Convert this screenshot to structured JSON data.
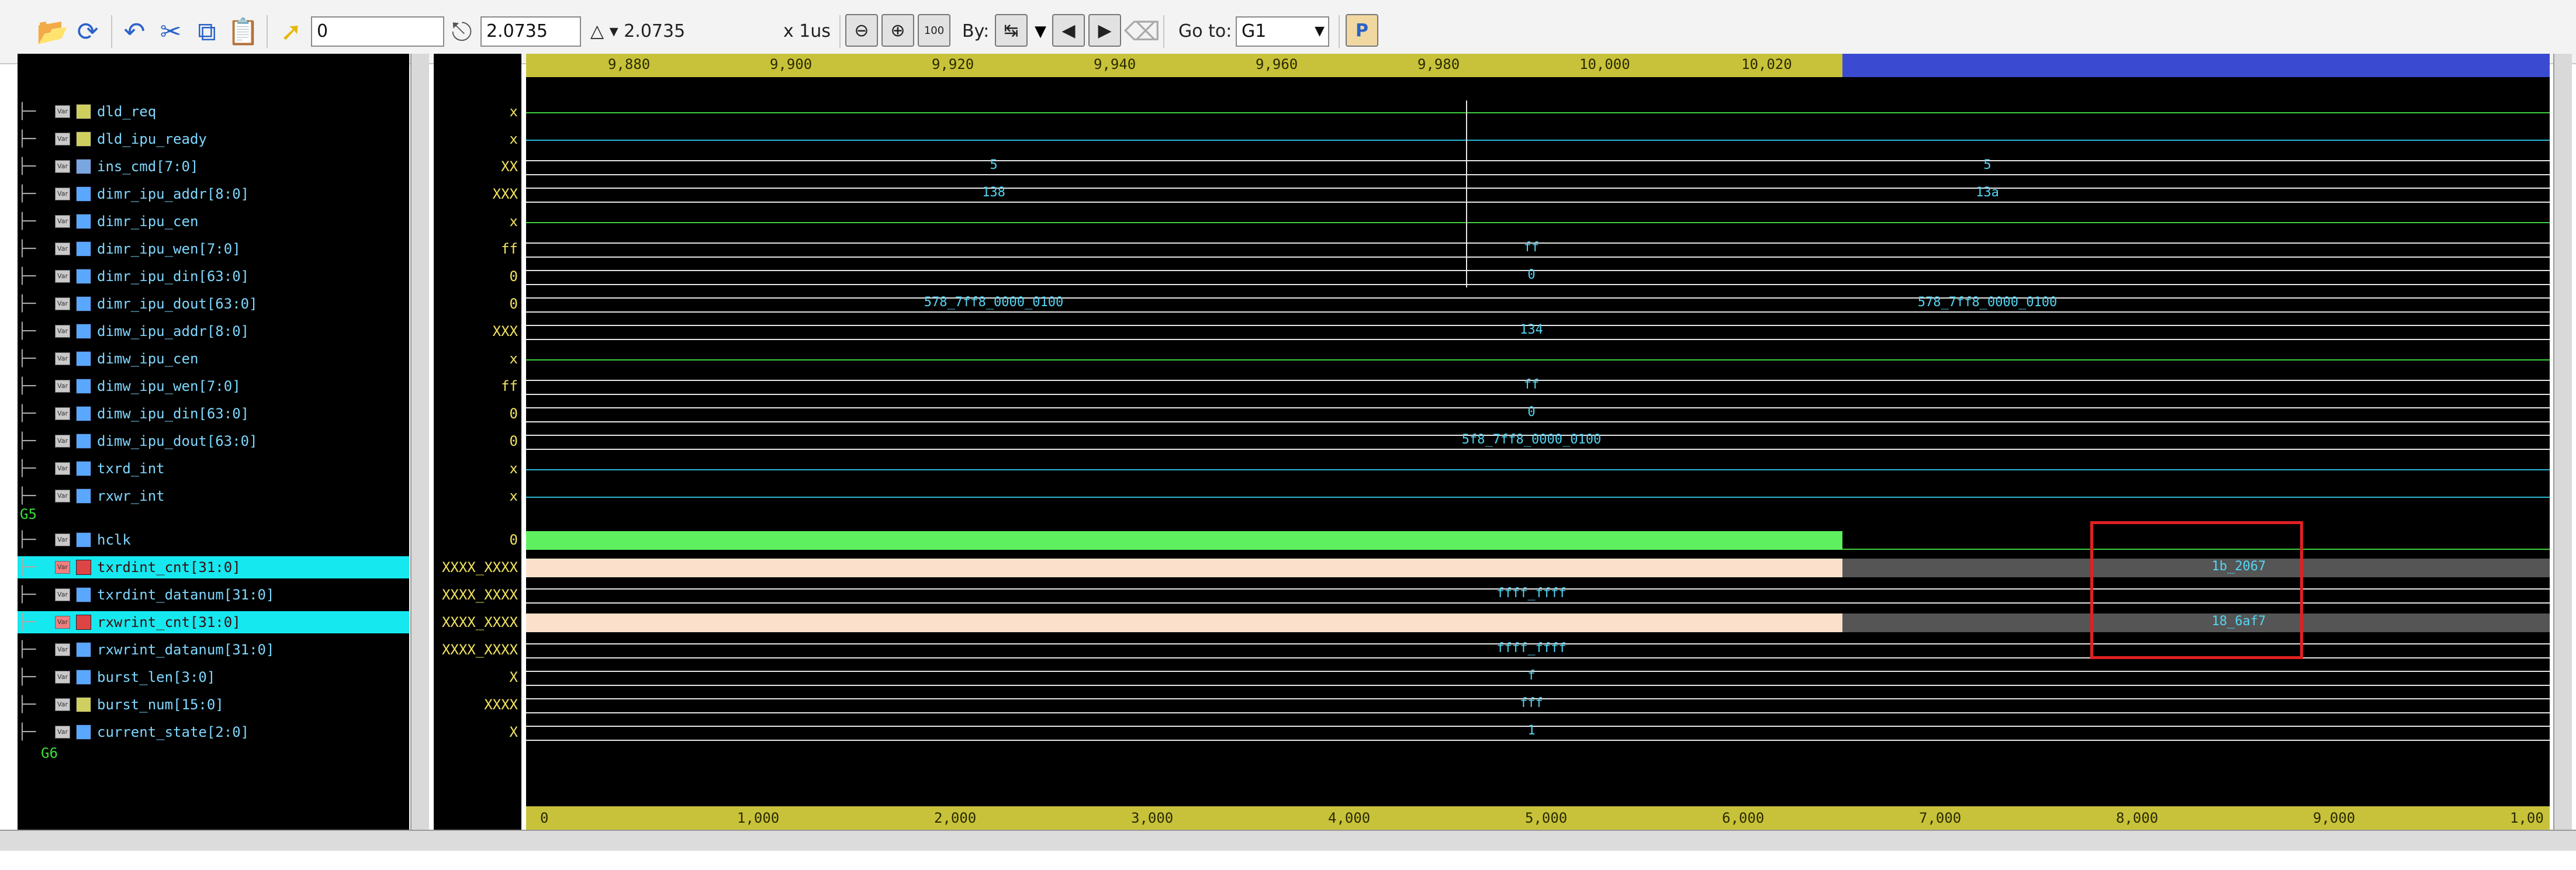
{
  "toolbar": {
    "time_field": "0",
    "marker_field": "2.0735",
    "delta_label": "△ ▾ 2.0735",
    "unit_label": "x 1us",
    "by_label": "By:",
    "goto_label": "Go to:",
    "goto_value": "G1",
    "fit_zoom_label": "100"
  },
  "top_ruler": [
    "9,880",
    "9,900",
    "9,920",
    "9,940",
    "9,960",
    "9,980",
    "10,000",
    "10,020"
  ],
  "bottom_ruler": [
    "0",
    "1,000",
    "2,000",
    "3,000",
    "4,000",
    "5,000",
    "6,000",
    "7,000",
    "8,000",
    "9,000",
    "1,00"
  ],
  "groups": {
    "g5": "G5",
    "g6": "G6"
  },
  "signals": [
    {
      "name": "dld_req",
      "value": "x",
      "type": "wire"
    },
    {
      "name": "dld_ipu_ready",
      "value": "x",
      "type": "wire"
    },
    {
      "name": "ins_cmd[7:0]",
      "value": "XX",
      "type": "bus"
    },
    {
      "name": "dimr_ipu_addr[8:0]",
      "value": "XXX",
      "type": "in"
    },
    {
      "name": "dimr_ipu_cen",
      "value": "x",
      "type": "in"
    },
    {
      "name": "dimr_ipu_wen[7:0]",
      "value": "ff",
      "type": "in"
    },
    {
      "name": "dimr_ipu_din[63:0]",
      "value": "0",
      "type": "in"
    },
    {
      "name": "dimr_ipu_dout[63:0]",
      "value": "0",
      "type": "out"
    },
    {
      "name": "dimw_ipu_addr[8:0]",
      "value": "XXX",
      "type": "in"
    },
    {
      "name": "dimw_ipu_cen",
      "value": "x",
      "type": "in"
    },
    {
      "name": "dimw_ipu_wen[7:0]",
      "value": "ff",
      "type": "in"
    },
    {
      "name": "dimw_ipu_din[63:0]",
      "value": "0",
      "type": "in"
    },
    {
      "name": "dimw_ipu_dout[63:0]",
      "value": "0",
      "type": "out"
    },
    {
      "name": "txrd_int",
      "value": "x",
      "type": "out"
    },
    {
      "name": "rxwr_int",
      "value": "x",
      "type": "out"
    },
    {
      "name": "hclk",
      "value": "0",
      "type": "out"
    },
    {
      "name": "txrdint_cnt[31:0]",
      "value": "XXXX_XXXX",
      "type": "reg",
      "selected": true
    },
    {
      "name": "txrdint_datanum[31:0]",
      "value": "XXXX_XXXX",
      "type": "out"
    },
    {
      "name": "rxwrint_cnt[31:0]",
      "value": "XXXX_XXXX",
      "type": "reg",
      "selected": true
    },
    {
      "name": "rxwrint_datanum[31:0]",
      "value": "XXXX_XXXX",
      "type": "out"
    },
    {
      "name": "burst_len[3:0]",
      "value": "X",
      "type": "in"
    },
    {
      "name": "burst_num[15:0]",
      "value": "XXXX",
      "type": "wire"
    },
    {
      "name": "current_state[2:0]",
      "value": "X",
      "type": "in"
    }
  ],
  "wave_values": {
    "ins_cmd_a": "5",
    "ins_cmd_b": "5",
    "dimr_addr_a": "138",
    "dimr_addr_b": "13a",
    "dimr_wen": "ff",
    "dimr_din": "0",
    "dimr_dout_a": "578_7ff8_0000_0100",
    "dimr_dout_b": "578_7ff8_0000_0100",
    "dimw_addr": "134",
    "dimw_wen": "ff",
    "dimw_din": "0",
    "dimw_dout": "5f8_7ff8_0000_0100",
    "txrdint_cnt": "1b_2067",
    "txrdint_datanum": "ffff_ffff",
    "rxwrint_cnt": "18_6af7",
    "rxwrint_datanum": "ffff_ffff",
    "burst_len": "f",
    "burst_num": "fff",
    "current_state": "1"
  },
  "colors": {
    "wave_green": "#3fcf3f",
    "wave_cyan": "#2bb7d6",
    "wave_white": "#e6e6e6",
    "hclk_fill": "#5ef05e",
    "cnt_fill": "#fbe1cc",
    "after_gray": "#555555",
    "highlight_red": "#e02020",
    "ruler_yellow": "#c8c23a",
    "ruler_blue": "#3a4bd1"
  }
}
